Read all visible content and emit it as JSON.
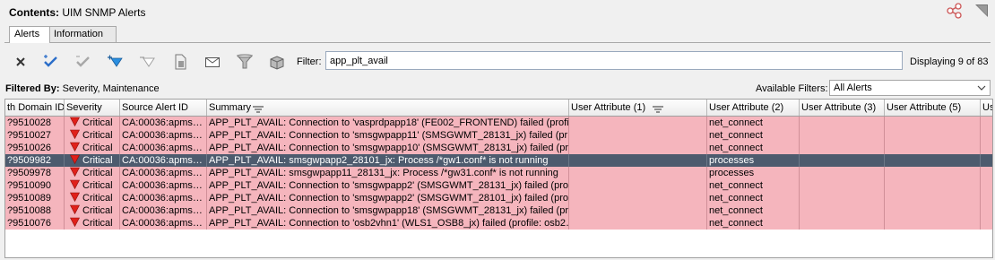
{
  "header": {
    "contents_label": "Contents:",
    "contents_value": "UIM SNMP Alerts"
  },
  "tabs": [
    {
      "label": "Alerts",
      "active": true
    },
    {
      "label": "Information",
      "active": false
    }
  ],
  "toolbar": {
    "icons": [
      "close-icon",
      "acknowledge-icon",
      "unacknowledge-icon",
      "filter-add-icon",
      "filter-remove-icon",
      "document-icon",
      "email-icon",
      "funnel-icon",
      "package-icon"
    ],
    "filter_label": "Filter:",
    "filter_value": "app_plt_avail",
    "displaying": "Displaying 9 of 83"
  },
  "filterbar": {
    "filtered_by_label": "Filtered By:",
    "filtered_by_value": "Severity, Maintenance",
    "available_label": "Available Filters:",
    "available_value": "All Alerts"
  },
  "grid": {
    "columns": [
      "th Domain ID",
      "Severity",
      "Source Alert ID",
      "Summary",
      "User Attribute (1)",
      "User Attribute (2)",
      "User Attribute (3)",
      "User Attribute (5)",
      "Us"
    ],
    "rows": [
      {
        "domain_id": "?9510028",
        "severity": "Critical",
        "source_alert_id": "CA:00036:apms…",
        "summary": "APP_PLT_AVAIL: Connection to 'vasprdpapp18' (FE002_FRONTEND) failed  (profi…",
        "ua1": "",
        "ua2": "net_connect",
        "ua3": "",
        "ua5": "",
        "selected": false
      },
      {
        "domain_id": "?9510027",
        "severity": "Critical",
        "source_alert_id": "CA:00036:apms…",
        "summary": "APP_PLT_AVAIL: Connection to 'smsgwpapp11' (SMSGWMT_28131_jx) failed  (pr…",
        "ua1": "",
        "ua2": "net_connect",
        "ua3": "",
        "ua5": "",
        "selected": false
      },
      {
        "domain_id": "?9510026",
        "severity": "Critical",
        "source_alert_id": "CA:00036:apms…",
        "summary": "APP_PLT_AVAIL: Connection to 'smsgwpapp10' (SMSGWMT_28131_jx) failed  (pr…",
        "ua1": "",
        "ua2": "net_connect",
        "ua3": "",
        "ua5": "",
        "selected": false
      },
      {
        "domain_id": "?9509982",
        "severity": "Critical",
        "source_alert_id": "CA:00036:apms…",
        "summary": "APP_PLT_AVAIL: smsgwpapp2_28101_jx: Process /*gw1.conf* is not running",
        "ua1": "",
        "ua2": "processes",
        "ua3": "",
        "ua5": "",
        "selected": true
      },
      {
        "domain_id": "?9509978",
        "severity": "Critical",
        "source_alert_id": "CA:00036:apms…",
        "summary": "APP_PLT_AVAIL: smsgwpapp11_28131_jx: Process /*gw31.conf* is not running",
        "ua1": "",
        "ua2": "processes",
        "ua3": "",
        "ua5": "",
        "selected": false
      },
      {
        "domain_id": "?9510090",
        "severity": "Critical",
        "source_alert_id": "CA:00036:apms…",
        "summary": "APP_PLT_AVAIL: Connection to 'smsgwpapp2' (SMSGWMT_28131_jx) failed  (pro…",
        "ua1": "",
        "ua2": "net_connect",
        "ua3": "",
        "ua5": "",
        "selected": false
      },
      {
        "domain_id": "?9510089",
        "severity": "Critical",
        "source_alert_id": "CA:00036:apms…",
        "summary": "APP_PLT_AVAIL: Connection to 'smsgwpapp2' (SMSGWMT_28101_jx) failed  (pro…",
        "ua1": "",
        "ua2": "net_connect",
        "ua3": "",
        "ua5": "",
        "selected": false
      },
      {
        "domain_id": "?9510088",
        "severity": "Critical",
        "source_alert_id": "CA:00036:apms…",
        "summary": "APP_PLT_AVAIL: Connection to 'smsgwpapp18' (SMSGWMT_28131_jx) failed  (pr…",
        "ua1": "",
        "ua2": "net_connect",
        "ua3": "",
        "ua5": "",
        "selected": false
      },
      {
        "domain_id": "?9510076",
        "severity": "Critical",
        "source_alert_id": "CA:00036:apms…",
        "summary": "APP_PLT_AVAIL: Connection to 'osb2vhn1' (WLS1_OSB8_jx) failed  (profile: osb2…",
        "ua1": "",
        "ua2": "net_connect",
        "ua3": "",
        "ua5": "",
        "selected": false
      }
    ]
  },
  "colors": {
    "row_critical": "#f5b5bd",
    "row_selected": "#4d5b6e",
    "critical_icon": "#e0201a"
  }
}
